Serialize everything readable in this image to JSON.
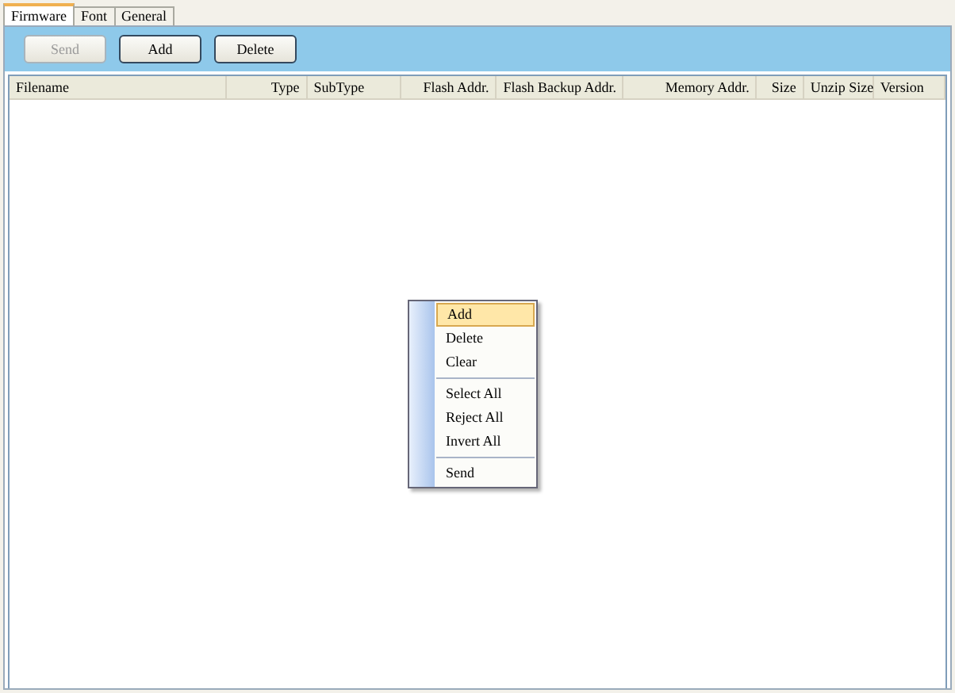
{
  "tabs": [
    {
      "label": "Firmware",
      "selected": true
    },
    {
      "label": "Font",
      "selected": false
    },
    {
      "label": "General",
      "selected": false
    }
  ],
  "toolbar": [
    {
      "label": "Send",
      "disabled": true
    },
    {
      "label": "Add",
      "disabled": false
    },
    {
      "label": "Delete",
      "disabled": false
    }
  ],
  "table": {
    "columns": [
      "Filename",
      "Type",
      "SubType",
      "Flash Addr.",
      "Flash Backup Addr.",
      "Memory Addr.",
      "Size",
      "Unzip Size",
      "Version"
    ]
  },
  "context_menu": [
    {
      "kind": "item",
      "label": "Add",
      "selected": true
    },
    {
      "kind": "item",
      "label": "Delete",
      "selected": false
    },
    {
      "kind": "item",
      "label": "Clear",
      "selected": false
    },
    {
      "kind": "separator"
    },
    {
      "kind": "item",
      "label": "Select All",
      "selected": false
    },
    {
      "kind": "item",
      "label": "Reject All",
      "selected": false
    },
    {
      "kind": "item",
      "label": "Invert All",
      "selected": false
    },
    {
      "kind": "separator"
    },
    {
      "kind": "item",
      "label": "Send",
      "selected": false
    }
  ]
}
